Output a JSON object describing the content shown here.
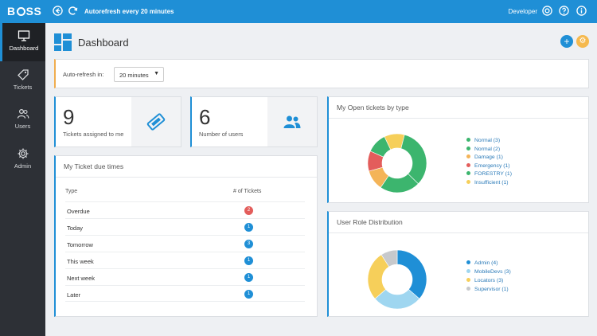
{
  "topbar": {
    "logo": "B SS",
    "logo_left": "B",
    "logo_right": "SS",
    "autorefresh_text": "Autorefresh every 20 minutes",
    "user": "Developer",
    "icons": [
      "back-arrow-icon",
      "refresh-icon",
      "support-icon",
      "help-icon",
      "info-icon"
    ]
  },
  "sidebar": {
    "items": [
      {
        "label": "Dashboard",
        "icon": "monitor-icon",
        "active": true
      },
      {
        "label": "Tickets",
        "icon": "tag-icon"
      },
      {
        "label": "Users",
        "icon": "users-icon"
      },
      {
        "label": "Admin",
        "icon": "gear-icon"
      }
    ]
  },
  "page": {
    "title": "Dashboard",
    "add_button": "+",
    "settings_button": "⚙"
  },
  "autorefresh": {
    "label": "Auto-refresh in:",
    "selected": "20 minutes"
  },
  "stats": [
    {
      "value": "9",
      "label": "Tickets assigned to me",
      "icon": "ticket-icon"
    },
    {
      "value": "6",
      "label": "Number of users",
      "icon": "users-icon"
    }
  ],
  "due_times": {
    "title": "My Ticket due times",
    "columns": [
      "Type",
      "# of Tickets"
    ],
    "rows": [
      {
        "type": "Overdue",
        "count": "2",
        "color": "#e35d5b"
      },
      {
        "type": "Today",
        "count": "1",
        "color": "#1f8fd6"
      },
      {
        "type": "Tomorrow",
        "count": "3",
        "color": "#1f8fd6"
      },
      {
        "type": "This week",
        "count": "1",
        "color": "#1f8fd6"
      },
      {
        "type": "Next week",
        "count": "1",
        "color": "#1f8fd6"
      },
      {
        "type": "Later",
        "count": "1",
        "color": "#1f8fd6"
      }
    ]
  },
  "open_tickets": {
    "title": "My Open tickets by type",
    "legend": [
      {
        "label": "Normal (3)",
        "color": "#3cb56e"
      },
      {
        "label": "Normal (2)",
        "color": "#3cb56e"
      },
      {
        "label": "Damage (1)",
        "color": "#f4b458"
      },
      {
        "label": "Emergency (1)",
        "color": "#e35d5b"
      },
      {
        "label": "FORESTRY (1)",
        "color": "#3cb56e"
      },
      {
        "label": "Insufficient (1)",
        "color": "#f6cf5a"
      }
    ]
  },
  "chart_data": [
    {
      "type": "pie",
      "title": "My Open tickets by type",
      "categories": [
        "Normal",
        "Normal",
        "Damage",
        "Emergency",
        "FORESTRY",
        "Insufficient"
      ],
      "values": [
        3,
        2,
        1,
        1,
        1,
        1
      ],
      "colors": [
        "#3cb56e",
        "#3cb56e",
        "#f4b458",
        "#e35d5b",
        "#3cb56e",
        "#f6cf5a"
      ],
      "donut": true,
      "legend": "right"
    },
    {
      "type": "pie",
      "title": "User Role Distribution",
      "categories": [
        "Admin",
        "MobileDevs",
        "Locators",
        "Supervisor"
      ],
      "values": [
        4,
        3,
        3,
        1
      ],
      "colors": [
        "#1f8fd6",
        "#9fd6f0",
        "#f6cf5a",
        "#c7c9cc"
      ],
      "donut": true,
      "legend": "right"
    }
  ],
  "roles": {
    "title": "User Role Distribution",
    "legend": [
      {
        "label": "Admin (4)",
        "color": "#1f8fd6"
      },
      {
        "label": "MobileDevs (3)",
        "color": "#9fd6f0"
      },
      {
        "label": "Locators (3)",
        "color": "#f6cf5a"
      },
      {
        "label": "Supervisor (1)",
        "color": "#c7c9cc"
      }
    ]
  }
}
